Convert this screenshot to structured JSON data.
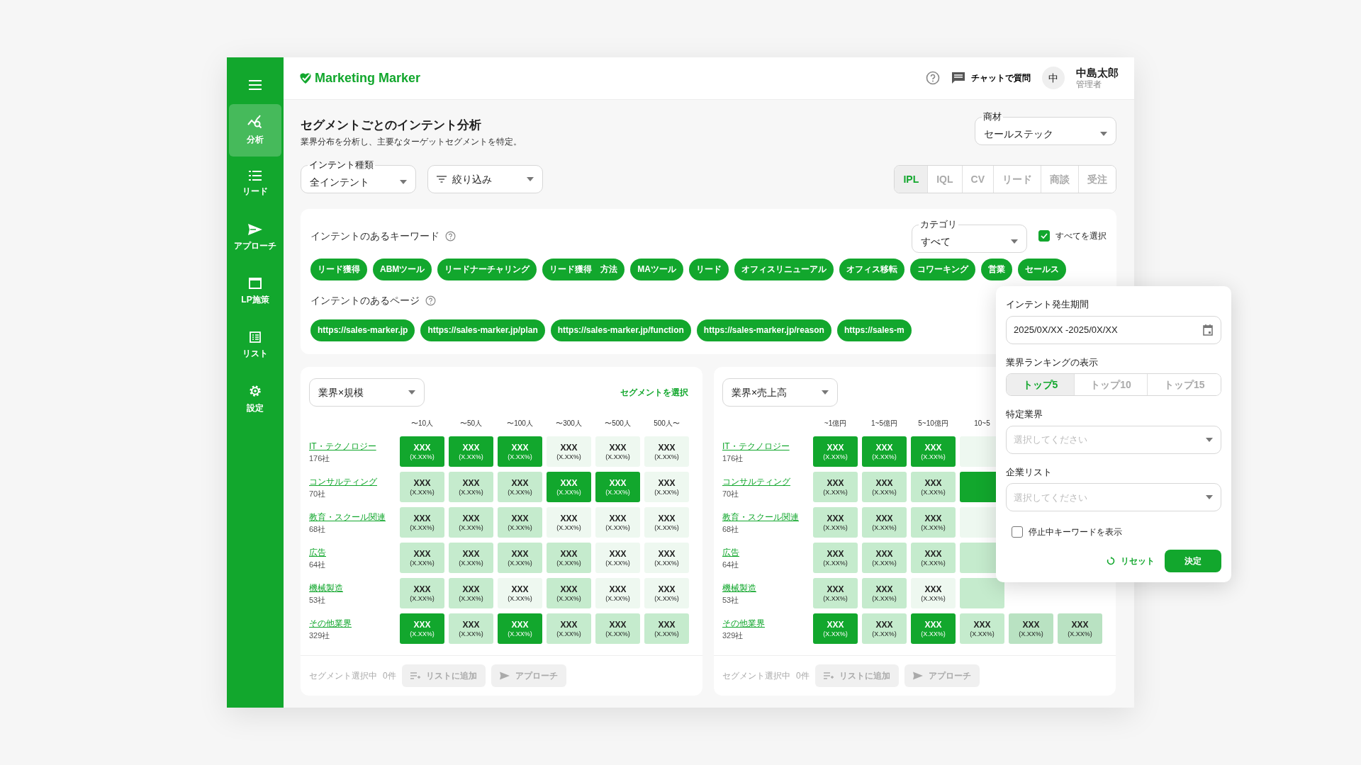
{
  "sidebar": {
    "items": [
      {
        "label": "分析",
        "kind": "analysis",
        "selected": true
      },
      {
        "label": "リード",
        "kind": "lead",
        "selected": false
      },
      {
        "label": "アプローチ",
        "kind": "approach",
        "selected": false
      },
      {
        "label": "LP施策",
        "kind": "lp",
        "selected": false
      },
      {
        "label": "リスト",
        "kind": "list",
        "selected": false
      },
      {
        "label": "設定",
        "kind": "settings",
        "selected": false
      }
    ]
  },
  "header": {
    "logo": "Marketing Marker",
    "chat_label": "チャットで質問",
    "avatar": "中",
    "user_name": "中島太郎",
    "user_role": "管理者"
  },
  "page": {
    "title": "セグメントごとのインテント分析",
    "subtitle": "業界分布を分析し、主要なターゲットセグメントを特定。"
  },
  "product_select": {
    "label": "商材",
    "value": "セールステック"
  },
  "intent_select": {
    "label": "インテント種類",
    "value": "全インテント"
  },
  "filter_select": {
    "value": "絞り込み"
  },
  "stage_tabs": [
    {
      "label": "IPL",
      "selected": true
    },
    {
      "label": "IQL",
      "selected": false
    },
    {
      "label": "CV",
      "selected": false
    },
    {
      "label": "リード",
      "selected": false
    },
    {
      "label": "商談",
      "selected": false
    },
    {
      "label": "受注",
      "selected": false
    }
  ],
  "keywords": {
    "title": "インテントのあるキーワード",
    "category_select": {
      "label": "カテゴリ",
      "value": "すべて"
    },
    "select_all": {
      "label": "すべてを選択",
      "checked": true
    },
    "chips": [
      "リード獲得",
      "ABMツール",
      "リードナーチャリング",
      "リード獲得　方法",
      "MAツール",
      "リード",
      "オフィスリニューアル",
      "オフィス移転",
      "コワーキング",
      "営業",
      "セールス"
    ]
  },
  "pages": {
    "title": "インテントのあるページ",
    "chips": [
      "https://sales-marker.jp",
      "https://sales-marker.jp/plan",
      "https://sales-marker.jp/function",
      "https://sales-marker.jp/reason",
      "https://sales-m"
    ]
  },
  "heatmaps": [
    {
      "select": "業界×規模",
      "action": "セグメントを選択",
      "columns": [
        "〜10人",
        "〜50人",
        "〜100人",
        "〜300人",
        "〜500人",
        "500人〜"
      ],
      "rows": [
        {
          "name": "IT・テクノロジー",
          "count": "176社",
          "cells": [
            {
              "value": "XXX",
              "pct": "(X.XX%)",
              "color": "#12a72d"
            },
            {
              "value": "XXX",
              "pct": "(X.XX%)",
              "color": "#12a72d"
            },
            {
              "value": "XXX",
              "pct": "(X.XX%)",
              "color": "#12a72d"
            },
            {
              "value": "XXX",
              "pct": "(X.XX%)",
              "color": "#eef8f0"
            },
            {
              "value": "XXX",
              "pct": "(X.XX%)",
              "color": "#eef8f0"
            },
            {
              "value": "XXX",
              "pct": "(X.XX%)",
              "color": "#eef8f0"
            }
          ]
        },
        {
          "name": "コンサルティング",
          "count": "70社",
          "cells": [
            {
              "value": "XXX",
              "pct": "(X.XX%)",
              "color": "#c5ebcd"
            },
            {
              "value": "XXX",
              "pct": "(X.XX%)",
              "color": "#c5ebcd"
            },
            {
              "value": "XXX",
              "pct": "(X.XX%)",
              "color": "#c5ebcd"
            },
            {
              "value": "XXX",
              "pct": "(X.XX%)",
              "color": "#12a72d"
            },
            {
              "value": "XXX",
              "pct": "(X.XX%)",
              "color": "#12a72d"
            },
            {
              "value": "XXX",
              "pct": "(X.XX%)",
              "color": "#eef8f0"
            }
          ]
        },
        {
          "name": "教育・スクール関連",
          "count": "68社",
          "cells": [
            {
              "value": "XXX",
              "pct": "(X.XX%)",
              "color": "#c5ebcd"
            },
            {
              "value": "XXX",
              "pct": "(X.XX%)",
              "color": "#c5ebcd"
            },
            {
              "value": "XXX",
              "pct": "(X.XX%)",
              "color": "#c5ebcd"
            },
            {
              "value": "XXX",
              "pct": "(X.XX%)",
              "color": "#eef8f0"
            },
            {
              "value": "XXX",
              "pct": "(X.XX%)",
              "color": "#eef8f0"
            },
            {
              "value": "XXX",
              "pct": "(X.XX%)",
              "color": "#eef8f0"
            }
          ]
        },
        {
          "name": "広告",
          "count": "64社",
          "cells": [
            {
              "value": "XXX",
              "pct": "(X.XX%)",
              "color": "#c5ebcd"
            },
            {
              "value": "XXX",
              "pct": "(X.XX%)",
              "color": "#c5ebcd"
            },
            {
              "value": "XXX",
              "pct": "(X.XX%)",
              "color": "#c5ebcd"
            },
            {
              "value": "XXX",
              "pct": "(X.XX%)",
              "color": "#c5ebcd"
            },
            {
              "value": "XXX",
              "pct": "(X.XX%)",
              "color": "#eef8f0"
            },
            {
              "value": "XXX",
              "pct": "(X.XX%)",
              "color": "#eef8f0"
            }
          ]
        },
        {
          "name": "機械製造",
          "count": "53社",
          "cells": [
            {
              "value": "XXX",
              "pct": "(X.XX%)",
              "color": "#c5ebcd"
            },
            {
              "value": "XXX",
              "pct": "(X.XX%)",
              "color": "#c5ebcd"
            },
            {
              "value": "XXX",
              "pct": "(X.XX%)",
              "color": "#eef8f0"
            },
            {
              "value": "XXX",
              "pct": "(X.XX%)",
              "color": "#c5ebcd"
            },
            {
              "value": "XXX",
              "pct": "(X.XX%)",
              "color": "#eef8f0"
            },
            {
              "value": "XXX",
              "pct": "(X.XX%)",
              "color": "#eef8f0"
            }
          ]
        },
        {
          "name": "その他業界",
          "count": "329社",
          "cells": [
            {
              "value": "XXX",
              "pct": "(X.XX%)",
              "color": "#12a72d"
            },
            {
              "value": "XXX",
              "pct": "(X.XX%)",
              "color": "#c5ebcd"
            },
            {
              "value": "XXX",
              "pct": "(X.XX%)",
              "color": "#12a72d"
            },
            {
              "value": "XXX",
              "pct": "(X.XX%)",
              "color": "#c5ebcd"
            },
            {
              "value": "XXX",
              "pct": "(X.XX%)",
              "color": "#c5ebcd"
            },
            {
              "value": "XXX",
              "pct": "(X.XX%)",
              "color": "#c5ebcd"
            }
          ]
        }
      ],
      "footer": {
        "status": "セグメント選択中",
        "count": "0件",
        "add_button": "リストに追加",
        "approach_button": "アプローチ"
      }
    },
    {
      "select": "業界×売上高",
      "columns": [
        "~1億円",
        "1~5億円",
        "5~10億円",
        "10~5"
      ],
      "rows": [
        {
          "name": "IT・テクノロジー",
          "count": "176社",
          "cells": [
            {
              "value": "XXX",
              "pct": "(X.XX%)",
              "color": "#12a72d"
            },
            {
              "value": "XXX",
              "pct": "(X.XX%)",
              "color": "#12a72d"
            },
            {
              "value": "XXX",
              "pct": "(X.XX%)",
              "color": "#12a72d"
            },
            {
              "color": "#eef8f0"
            }
          ]
        },
        {
          "name": "コンサルティング",
          "count": "70社",
          "cells": [
            {
              "value": "XXX",
              "pct": "(X.XX%)",
              "color": "#c5ebcd"
            },
            {
              "value": "XXX",
              "pct": "(X.XX%)",
              "color": "#c5ebcd"
            },
            {
              "value": "XXX",
              "pct": "(X.XX%)",
              "color": "#c5ebcd"
            },
            {
              "color": "#12a72d"
            }
          ]
        },
        {
          "name": "教育・スクール関連",
          "count": "68社",
          "cells": [
            {
              "value": "XXX",
              "pct": "(X.XX%)",
              "color": "#c5ebcd"
            },
            {
              "value": "XXX",
              "pct": "(X.XX%)",
              "color": "#c5ebcd"
            },
            {
              "value": "XXX",
              "pct": "(X.XX%)",
              "color": "#c5ebcd"
            },
            {
              "color": "#eef8f0"
            }
          ]
        },
        {
          "name": "広告",
          "count": "64社",
          "cells": [
            {
              "value": "XXX",
              "pct": "(X.XX%)",
              "color": "#c5ebcd"
            },
            {
              "value": "XXX",
              "pct": "(X.XX%)",
              "color": "#c5ebcd"
            },
            {
              "value": "XXX",
              "pct": "(X.XX%)",
              "color": "#c5ebcd"
            },
            {
              "color": "#c5ebcd"
            }
          ]
        },
        {
          "name": "機械製造",
          "count": "53社",
          "cells": [
            {
              "value": "XXX",
              "pct": "(X.XX%)",
              "color": "#c5ebcd"
            },
            {
              "value": "XXX",
              "pct": "(X.XX%)",
              "color": "#c5ebcd"
            },
            {
              "value": "XXX",
              "pct": "(X.XX%)",
              "color": "#eef8f0"
            },
            {
              "color": "#c5ebcd"
            }
          ]
        },
        {
          "name": "その他業界",
          "count": "329社",
          "cells": [
            {
              "value": "XXX",
              "pct": "(X.XX%)",
              "color": "#12a72d"
            },
            {
              "value": "XXX",
              "pct": "(X.XX%)",
              "color": "#c5ebcd"
            },
            {
              "value": "XXX",
              "pct": "(X.XX%)",
              "color": "#12a72d"
            },
            {
              "value": "XXX",
              "pct": "(X.XX%)",
              "color": "#c5ebcd"
            },
            {
              "value": "XXX",
              "pct": "(X.XX%)",
              "color": "#b9e2c2"
            },
            {
              "value": "XXX",
              "pct": "(X.XX%)",
              "color": "#b9e2c2"
            }
          ]
        }
      ],
      "footer": {
        "status": "セグメント選択中",
        "count": "0件",
        "add_button": "リストに追加",
        "approach_button": "アプローチ"
      }
    }
  ],
  "popover": {
    "period_label": "インテント発生期間",
    "period_value": "2025/0X/XX -2025/0X/XX",
    "ranking_label": "業界ランキングの表示",
    "ranking_tabs": [
      {
        "label": "トップ5",
        "selected": true
      },
      {
        "label": "トップ10",
        "selected": false
      },
      {
        "label": "トップ15",
        "selected": false
      }
    ],
    "industry_label": "特定業界",
    "industry_select": {
      "placeholder": "選択してください"
    },
    "list_label": "企業リスト",
    "list_select": {
      "placeholder": "選択してください"
    },
    "stopped_keywords": {
      "label": "停止中キーワードを表示",
      "checked": false
    },
    "reset_button": "リセット",
    "apply_button": "決定"
  }
}
